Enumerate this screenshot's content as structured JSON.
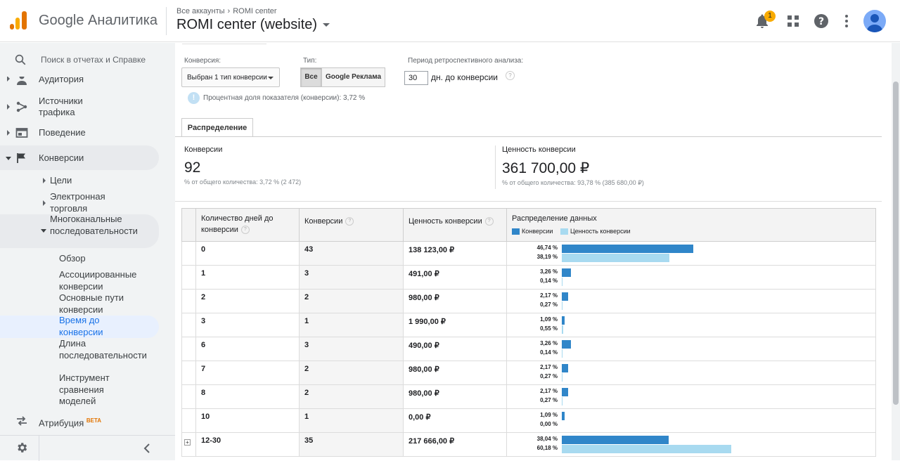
{
  "header": {
    "product_name": "Google Аналитика",
    "breadcrumb": [
      "Все аккаунты",
      "ROMI center"
    ],
    "property_name": "ROMI center (website)",
    "notification_count": "1"
  },
  "sidebar": {
    "search_placeholder": "Поиск в отчетах и Справке",
    "items": [
      {
        "label": "Аудитория"
      },
      {
        "label": "Источники трафика"
      },
      {
        "label": "Поведение"
      },
      {
        "label": "Конверсии"
      }
    ],
    "conversions_sub": [
      {
        "label": "Цели"
      },
      {
        "label": "Электронная торговля"
      },
      {
        "label": "Многоканальные последовательности"
      }
    ],
    "mcf_sub": [
      {
        "label": "Обзор"
      },
      {
        "label": "Ассоциированные конверсии"
      },
      {
        "label": "Основные пути конверсии"
      },
      {
        "label": "Время до конверсии"
      },
      {
        "label": "Длина последовательности"
      },
      {
        "label": "Инструмент сравнения моделей"
      }
    ],
    "attribution": {
      "label": "Атрибуция",
      "badge": "BETA"
    }
  },
  "controls": {
    "conversion_label": "Конверсия:",
    "conversion_value": "Выбран 1 тип конверсии",
    "type_label": "Тип:",
    "type_options": [
      "Все",
      "Google Реклама"
    ],
    "type_selected": "Все",
    "lookback_label": "Период ретроспективного анализа:",
    "lookback_value": "30",
    "lookback_suffix": "дн. до конверсии",
    "info_text": "Процентная доля показателя (конверсии): 3,72 %"
  },
  "tab": {
    "label": "Распределение"
  },
  "summary": {
    "conversions": {
      "title": "Конверсии",
      "value": "92",
      "sub": "% от общего количества: 3,72 % (2 472)"
    },
    "value": {
      "title": "Ценность конверсии",
      "value": "361 700,00 ₽",
      "sub": "% от общего количества: 93,78 % (385 680,00 ₽)"
    }
  },
  "table": {
    "headers": {
      "days": "Количество дней до конверсии",
      "conversions": "Конверсии",
      "value": "Ценность конверсии",
      "distribution": "Распределение данных"
    },
    "legend": {
      "conversions": "Конверсии",
      "value": "Ценность конверсии"
    },
    "colors": {
      "conversions": "#3086c9",
      "value": "#a8daf0"
    },
    "rows": [
      {
        "days": "0",
        "conversions": "43",
        "value": "138 123,00 ₽",
        "pct_conv": "46,74 %",
        "pct_val": "38,19 %",
        "conv_share": 46.74,
        "val_share": 38.19
      },
      {
        "days": "1",
        "conversions": "3",
        "value": "491,00 ₽",
        "pct_conv": "3,26 %",
        "pct_val": "0,14 %",
        "conv_share": 3.26,
        "val_share": 0.14
      },
      {
        "days": "2",
        "conversions": "2",
        "value": "980,00 ₽",
        "pct_conv": "2,17 %",
        "pct_val": "0,27 %",
        "conv_share": 2.17,
        "val_share": 0.27
      },
      {
        "days": "3",
        "conversions": "1",
        "value": "1 990,00 ₽",
        "pct_conv": "1,09 %",
        "pct_val": "0,55 %",
        "conv_share": 1.09,
        "val_share": 0.55
      },
      {
        "days": "6",
        "conversions": "3",
        "value": "490,00 ₽",
        "pct_conv": "3,26 %",
        "pct_val": "0,14 %",
        "conv_share": 3.26,
        "val_share": 0.14
      },
      {
        "days": "7",
        "conversions": "2",
        "value": "980,00 ₽",
        "pct_conv": "2,17 %",
        "pct_val": "0,27 %",
        "conv_share": 2.17,
        "val_share": 0.27
      },
      {
        "days": "8",
        "conversions": "2",
        "value": "980,00 ₽",
        "pct_conv": "2,17 %",
        "pct_val": "0,27 %",
        "conv_share": 2.17,
        "val_share": 0.27
      },
      {
        "days": "10",
        "conversions": "1",
        "value": "0,00 ₽",
        "pct_conv": "1,09 %",
        "pct_val": "0,00 %",
        "conv_share": 1.09,
        "val_share": 0.0
      },
      {
        "days": "12-30",
        "conversions": "35",
        "value": "217 666,00 ₽",
        "pct_conv": "38,04 %",
        "pct_val": "60,18 %",
        "conv_share": 38.04,
        "val_share": 60.18,
        "expandable": true
      }
    ]
  }
}
